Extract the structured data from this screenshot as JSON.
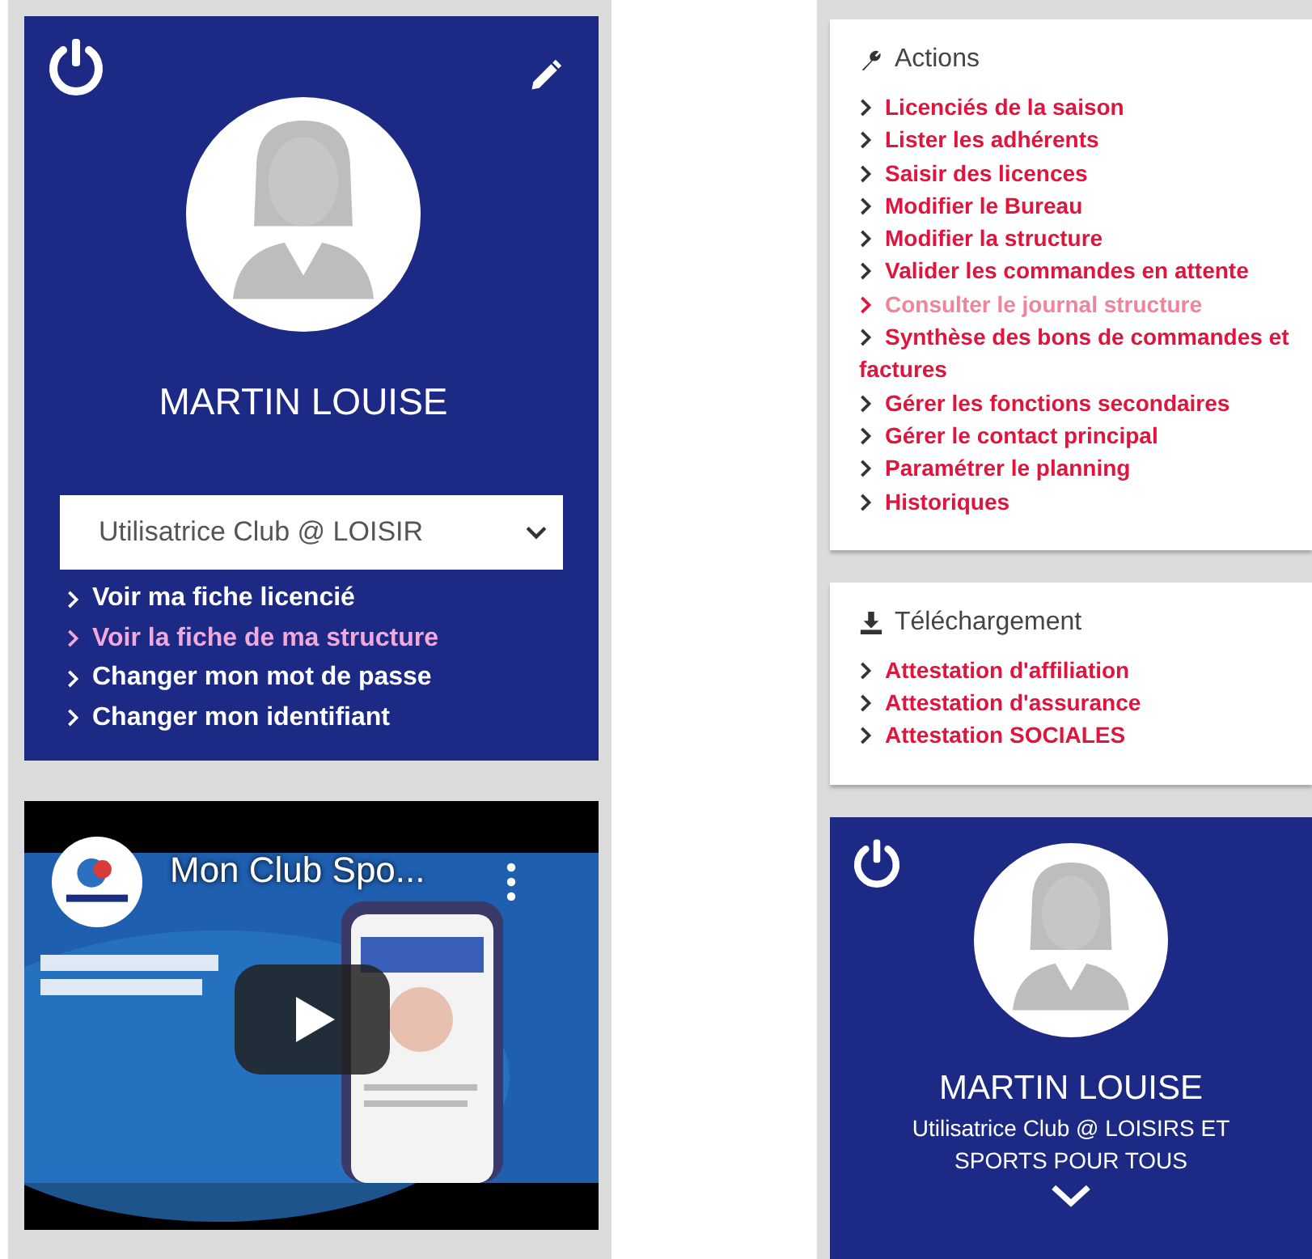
{
  "profile_card": {
    "name": "MARTIN LOUISE",
    "role_select": {
      "value": "Utilisatrice Club @ LOISIR"
    },
    "links": [
      {
        "label": "Voir ma fiche licencié",
        "visited": false
      },
      {
        "label": "Voir la fiche de ma structure",
        "visited": true
      },
      {
        "label": "Changer mon mot de passe",
        "visited": false
      },
      {
        "label": "Changer mon identifiant",
        "visited": false
      }
    ]
  },
  "video": {
    "title": "Mon Club Spo..."
  },
  "actions": {
    "title": "Actions",
    "links": [
      {
        "label": "Licenciés de la saison",
        "disabled": false
      },
      {
        "label": "Lister les adhérents",
        "disabled": false
      },
      {
        "label": "Saisir des licences",
        "disabled": false
      },
      {
        "label": "Modifier le Bureau",
        "disabled": false
      },
      {
        "label": "Modifier la structure",
        "disabled": false
      },
      {
        "label": "Valider les commandes en attente",
        "disabled": false
      },
      {
        "label": "Consulter le journal structure",
        "disabled": true
      },
      {
        "label": "Synthèse des bons de commandes et factures",
        "disabled": false
      },
      {
        "label": "Gérer les fonctions secondaires",
        "disabled": false
      },
      {
        "label": "Gérer le contact principal",
        "disabled": false
      },
      {
        "label": "Paramétrer le planning",
        "disabled": false
      },
      {
        "label": "Historiques",
        "disabled": false
      }
    ]
  },
  "downloads": {
    "title": "Téléchargement",
    "links": [
      {
        "label": "Attestation d'affiliation",
        "disabled": false
      },
      {
        "label": "Attestation d'assurance",
        "disabled": false
      },
      {
        "label": "Attestation SOCIALES",
        "disabled": false
      }
    ]
  },
  "mini_profile": {
    "name": "MARTIN LOUISE",
    "role": "Utilisatrice Club @ LOISIRS ET SPORTS POUR TOUS"
  }
}
